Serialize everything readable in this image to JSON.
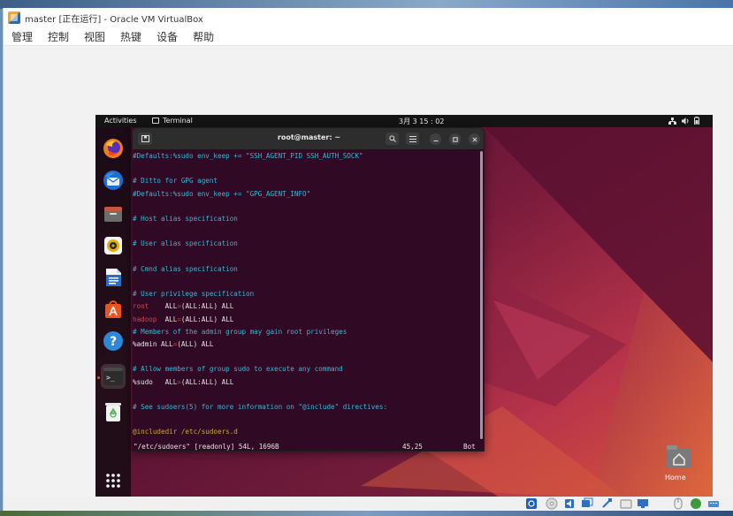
{
  "window": {
    "title": "master [正在运行] - Oracle VM VirtualBox",
    "menu": [
      "管理",
      "控制",
      "视图",
      "热键",
      "设备",
      "帮助"
    ]
  },
  "guest": {
    "topbar": {
      "activities": "Activities",
      "app": "Terminal",
      "clock": "3月 3 15 : 02"
    },
    "dock_items": [
      "firefox-icon",
      "thunderbird-icon",
      "files-icon",
      "rhythmbox-icon",
      "libreoffice-writer-icon",
      "app-center-icon",
      "help-icon",
      "terminal-icon",
      "trash-icon",
      "show-apps-icon"
    ],
    "desktop": {
      "home_label": "Home"
    },
    "terminal": {
      "title": "root@master: ~",
      "lines": [
        {
          "text": "#Defaults:%sudo env_keep += \"SSH_AGENT_PID SSH_AUTH_SOCK\"",
          "kind": "comment"
        },
        {
          "text": "",
          "kind": "plain"
        },
        {
          "text": "# Ditto for GPG agent",
          "kind": "comment"
        },
        {
          "text": "#Defaults:%sudo env_keep += \"GPG_AGENT_INFO\"",
          "kind": "comment"
        },
        {
          "text": "",
          "kind": "plain"
        },
        {
          "text": "# Host alias specification",
          "kind": "comment"
        },
        {
          "text": "",
          "kind": "plain"
        },
        {
          "text": "# User alias specification",
          "kind": "comment"
        },
        {
          "text": "",
          "kind": "plain"
        },
        {
          "text": "# Cmnd alias specification",
          "kind": "comment"
        },
        {
          "text": "",
          "kind": "plain"
        },
        {
          "text": "# User privilege specification",
          "kind": "comment"
        },
        {
          "text": "root    ALL=(ALL:ALL) ALL",
          "kind": "priv",
          "user": "root"
        },
        {
          "text": "hadoop  ALL=(ALL:ALL) ALL",
          "kind": "priv",
          "user": "hadoop"
        },
        {
          "text": "# Members of the admin group may gain root privileges",
          "kind": "comment"
        },
        {
          "text": "%admin ALL=(ALL) ALL",
          "kind": "privgroup",
          "user": "%admin"
        },
        {
          "text": "",
          "kind": "plain"
        },
        {
          "text": "# Allow members of group sudo to execute any command",
          "kind": "comment"
        },
        {
          "text": "%sudo   ALL=(ALL:ALL) ALL",
          "kind": "privgroup",
          "user": "%sudo"
        },
        {
          "text": "",
          "kind": "plain"
        },
        {
          "text": "# See sudoers(5) for more information on \"@include\" directives:",
          "kind": "comment"
        },
        {
          "text": "",
          "kind": "plain"
        },
        {
          "text": "@includedir /etc/sudoers.d",
          "kind": "include"
        }
      ],
      "status_left": "\"/etc/sudoers\" [readonly] 54L, 1696B",
      "status_pos": "45,25",
      "status_right": "Bot"
    }
  },
  "colors": {
    "comment": "#34b9d6",
    "keyword": "#d04747",
    "include": "#c5aa3b",
    "terminal_bg": "#300a24"
  }
}
